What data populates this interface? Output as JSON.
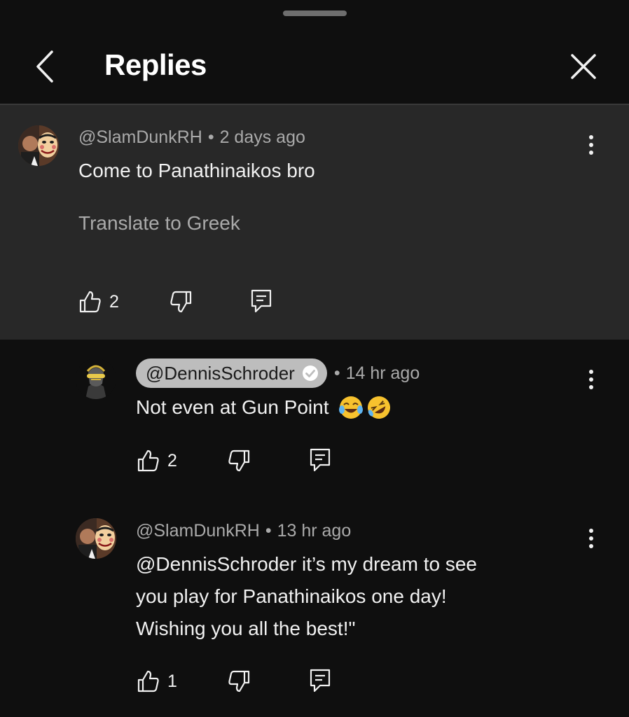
{
  "header": {
    "title": "Replies"
  },
  "parent": {
    "author": "@SlamDunkRH",
    "time": "2 days ago",
    "text": "Come to Panathinaikos bro",
    "translate": "Translate to Greek",
    "likes": "2"
  },
  "replies": [
    {
      "author": "@DennisSchroder",
      "verified": true,
      "time": "14 hr ago",
      "text": "Not even at Gun Point",
      "emojis": [
        "face-with-tears-of-joy",
        "rolling-on-floor-laughing"
      ],
      "likes": "2"
    },
    {
      "author": "@SlamDunkRH",
      "time": "13 hr ago",
      "lines": [
        "@DennisSchroder  it’s my dream to see",
        "you play for Panathinaikos one day!",
        "Wishing you all the best!\""
      ],
      "likes": "1"
    }
  ],
  "dot": "•",
  "colors": {
    "background": "#0f0f0f",
    "highlight": "#282828",
    "secondary_text": "#aaaaaa",
    "badge": "#bdbdbd"
  },
  "icons": [
    "back-chevron-icon",
    "close-icon",
    "more-vert-icon",
    "thumb-up-icon",
    "thumb-down-icon",
    "reply-icon",
    "verified-check-icon"
  ]
}
